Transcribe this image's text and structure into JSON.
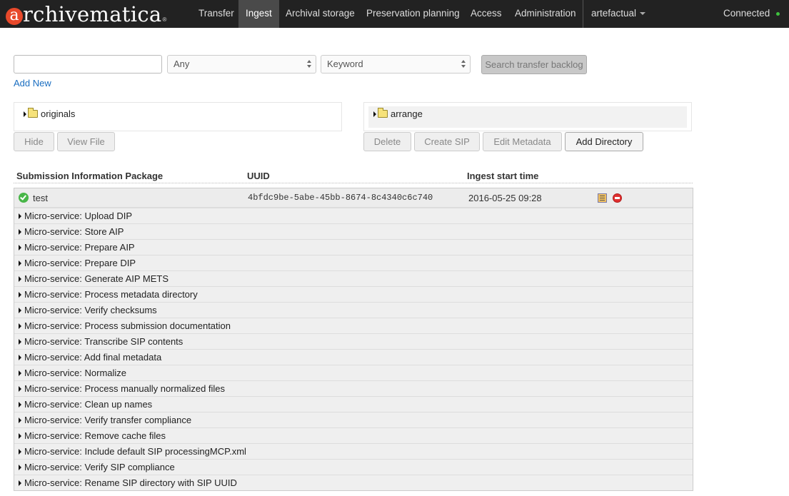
{
  "nav": {
    "brand_initial": "a",
    "brand_rest": "rchivematica",
    "brand_mark": "®",
    "items": [
      {
        "label": "Transfer"
      },
      {
        "label": "Ingest"
      },
      {
        "label": "Archival storage"
      },
      {
        "label": "Preservation planning"
      },
      {
        "label": "Access"
      },
      {
        "label": "Administration"
      }
    ],
    "user": "artefactual",
    "status": "Connected",
    "status_color": "#3ec13e"
  },
  "search": {
    "query_value": "",
    "scope_selected": "Any",
    "type_selected": "Keyword",
    "search_button": "Search transfer backlog",
    "add_new": "Add New"
  },
  "backlog": {
    "folder": "originals",
    "buttons": {
      "hide": "Hide",
      "view_file": "View File"
    }
  },
  "arrange": {
    "folder": "arrange",
    "buttons": {
      "delete": "Delete",
      "create_sip": "Create SIP",
      "edit_metadata": "Edit Metadata",
      "add_directory": "Add Directory"
    }
  },
  "table": {
    "headers": {
      "sip": "Submission Information Package",
      "uuid": "UUID",
      "start": "Ingest start time"
    },
    "sip": {
      "name": "test",
      "uuid": "4bfdc9be-5abe-45bb-8674-8c4340c6c740",
      "start": "2016-05-25 09:28",
      "status_icon": "check-circle-icon",
      "status_color": "#48b648"
    },
    "microservices": [
      "Micro-service: Upload DIP",
      "Micro-service: Store AIP",
      "Micro-service: Prepare AIP",
      "Micro-service: Prepare DIP",
      "Micro-service: Generate AIP METS",
      "Micro-service: Process metadata directory",
      "Micro-service: Verify checksums",
      "Micro-service: Process submission documentation",
      "Micro-service: Transcribe SIP contents",
      "Micro-service: Add final metadata",
      "Micro-service: Normalize",
      "Micro-service: Process manually normalized files",
      "Micro-service: Clean up names",
      "Micro-service: Verify transfer compliance",
      "Micro-service: Remove cache files",
      "Micro-service: Include default SIP processingMCP.xml",
      "Micro-service: Verify SIP compliance",
      "Micro-service: Rename SIP directory with SIP UUID"
    ]
  }
}
